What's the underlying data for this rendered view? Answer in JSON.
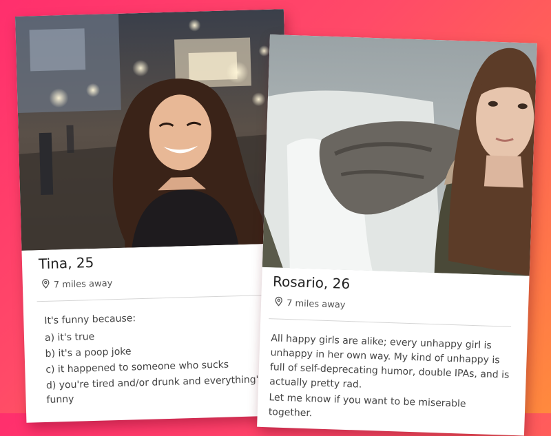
{
  "profiles": [
    {
      "name": "Tina",
      "age": "25",
      "distance": "7 miles away",
      "bio": [
        "It's funny because:",
        "a) it's true",
        "b) it's a poop joke",
        "c) it happened to someone who sucks",
        "d) you're tired and/or drunk and everything's funny"
      ]
    },
    {
      "name": "Rosario",
      "age": "26",
      "distance": "7 miles away",
      "bio": [
        "All happy girls are alike; every unhappy girl is unhappy in her own way. My kind of unhappy is full of self-deprecating humor, double IPAs, and is actually pretty rad.",
        "Let me know if you want to be miserable together."
      ]
    }
  ],
  "colors": {
    "background_start": "#ff2f6d",
    "background_end": "#ff8a3d"
  },
  "icons": {
    "location": "location-pin-icon"
  }
}
